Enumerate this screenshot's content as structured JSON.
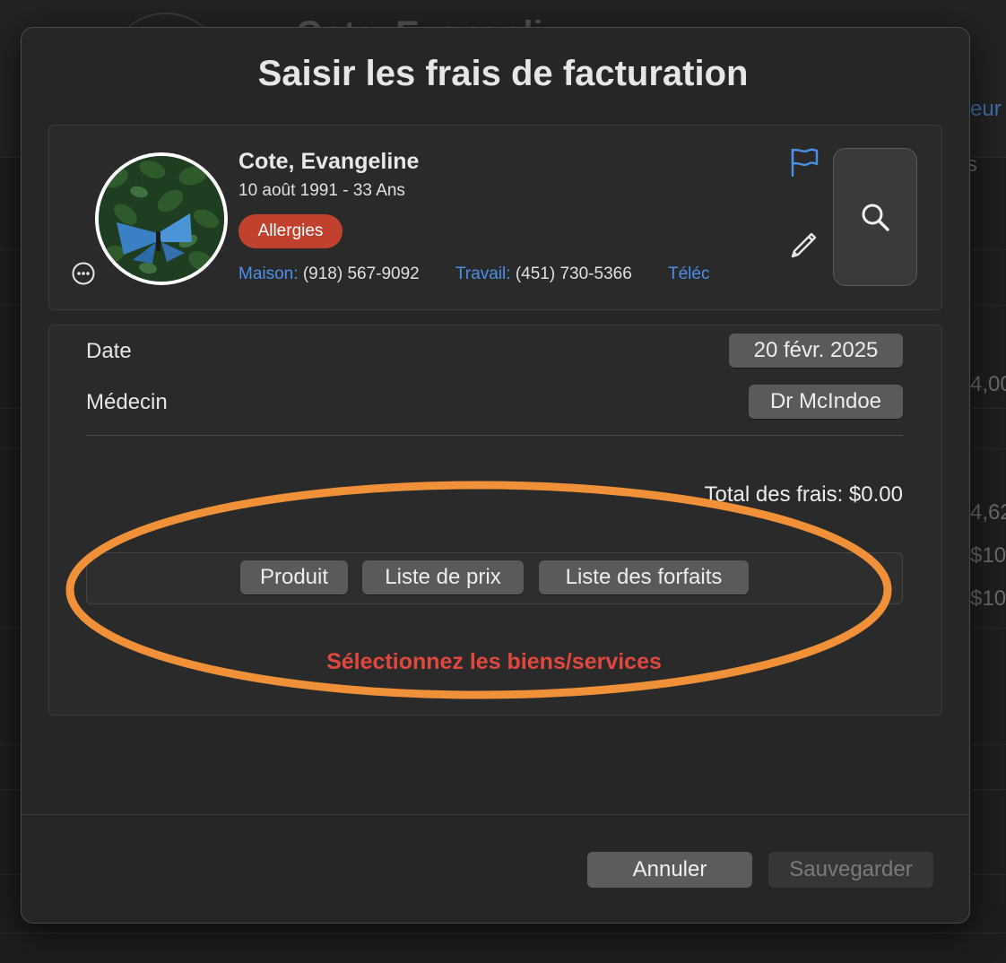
{
  "background": {
    "patient_name_partial": "Cote, Evangeli",
    "side_texts": [
      "eur",
      "s",
      "4,00",
      "4,62",
      "$10",
      "$10"
    ]
  },
  "dialog": {
    "title": "Saisir les frais de facturation"
  },
  "patient": {
    "name": "Cote, Evangeline",
    "dob": "10 août 1991 - 33 Ans",
    "allergies_label": "Allergies",
    "phones": [
      {
        "label": "Maison:",
        "value": "(918) 567-9092"
      },
      {
        "label": "Travail:",
        "value": "(451) 730-5366"
      },
      {
        "label": "Téléc",
        "value": ""
      }
    ],
    "icons": {
      "more": "ellipsis-circle-icon",
      "flag": "flag-icon",
      "edit": "pencil-icon",
      "search": "magnifier-icon"
    }
  },
  "form": {
    "date_label": "Date",
    "date_value": "20 févr. 2025",
    "doctor_label": "Médecin",
    "doctor_value": "Dr McIndoe",
    "total_label": "Total des frais: $0.00",
    "segments": [
      "Produit",
      "Liste de prix",
      "Liste des forfaits"
    ],
    "hint": "Sélectionnez les biens/services"
  },
  "footer": {
    "cancel_label": "Annuler",
    "save_label": "Sauvegarder"
  },
  "colors": {
    "accent_blue": "#4a8fe8",
    "allergy_red": "#c0412e",
    "hint_red": "#e0473f",
    "annotation_orange": "#f0913a"
  }
}
